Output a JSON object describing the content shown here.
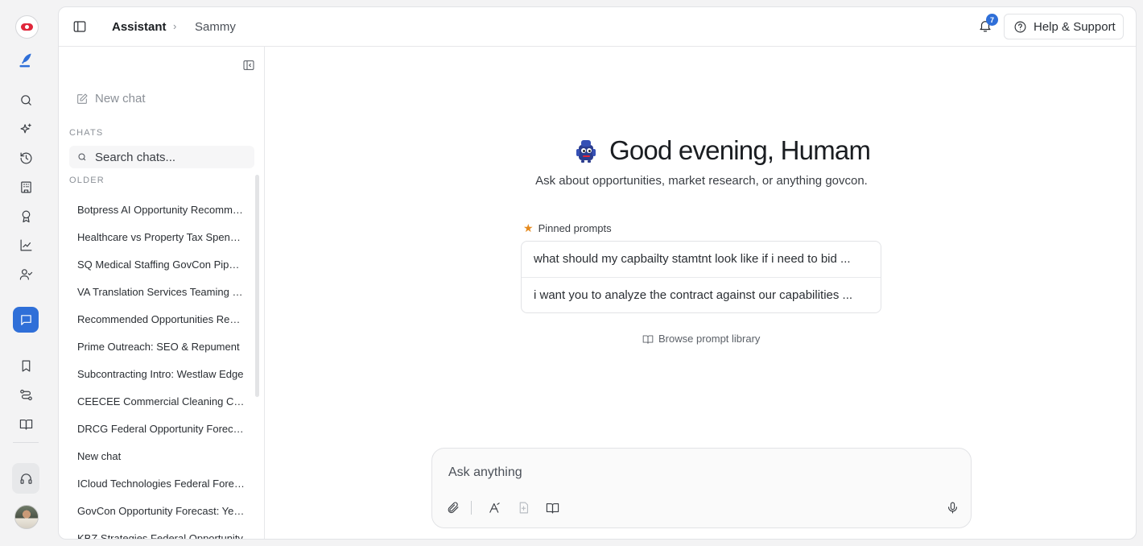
{
  "header": {
    "breadcrumb_root": "Assistant",
    "breadcrumb_leaf": "Sammy",
    "notification_count": "7",
    "help_label": "Help & Support"
  },
  "sidebar": {
    "new_chat_label": "New chat",
    "chats_section": "CHATS",
    "search_placeholder": "Search chats...",
    "older_section": "OLDER",
    "chats": [
      "Botpress AI Opportunity Recommendations",
      "Healthcare vs Property Tax Spending",
      "SQ Medical Staffing GovCon Pipeline",
      "VA Translation Services Teaming Bid",
      "Recommended Opportunities Review",
      "Prime Outreach: SEO & Repument",
      "Subcontracting Intro: Westlaw Edge",
      "CEECEE Commercial Cleaning Capabilities",
      "DRCG Federal Opportunity Forecast",
      "New chat",
      "ICloud Technologies Federal Forecast",
      "GovCon Opportunity Forecast: Yeiser",
      "KBZ Strategies Federal Opportunity"
    ]
  },
  "main": {
    "greeting": "Good evening, Humam",
    "subtitle": "Ask about opportunities, market research, or anything govcon.",
    "pinned_label": "Pinned prompts",
    "pinned_prompts": [
      "what should my capbailty stamtnt look like if i need to bid ...",
      "i want you to analyze the contract against our capabilities ..."
    ],
    "browse_label": "Browse prompt library",
    "composer_placeholder": "Ask anything"
  },
  "colors": {
    "accent": "#2f6fd8",
    "pinned_star": "#e58a1e",
    "logo_red": "#e0263a"
  }
}
